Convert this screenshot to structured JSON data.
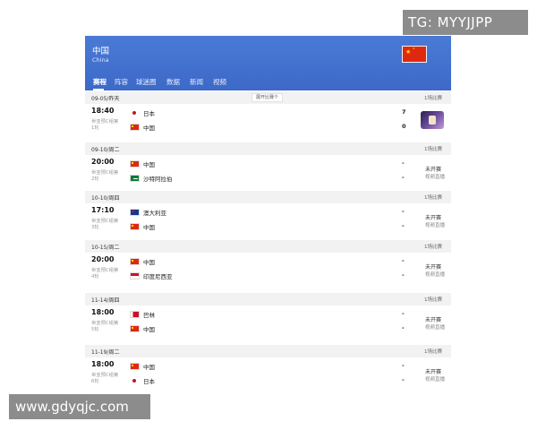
{
  "watermarks": {
    "top_right": "TG: MYYJJPP",
    "bottom_left": "www.gdyqjc.com"
  },
  "header": {
    "team_name": "中国",
    "team_name_en": "China"
  },
  "tabs": [
    "赛程",
    "阵容",
    "球迷圈",
    "数据",
    "新闻",
    "视频"
  ],
  "more_button": "展开比赛个",
  "groups": [
    {
      "date": "09-05/昨天",
      "count": "1场比赛",
      "matches": [
        {
          "time": "18:40",
          "competition": "世亚预C组第",
          "round": "1轮",
          "home": "日本",
          "home_flag": "jp",
          "away": "中国",
          "away_flag": "cn",
          "home_score": "7",
          "away_score": "0",
          "status": "",
          "status_sub": "",
          "has_thumb": true
        }
      ]
    },
    {
      "date": "09-10/周二",
      "count": "1场比赛",
      "matches": [
        {
          "time": "20:00",
          "competition": "世亚预C组第",
          "round": "2轮",
          "home": "中国",
          "home_flag": "cn",
          "away": "沙特阿拉伯",
          "away_flag": "sa",
          "home_score": "-",
          "away_score": "-",
          "status": "未开赛",
          "status_sub": "视频直播",
          "has_thumb": false
        }
      ]
    },
    {
      "date": "10-10/周四",
      "count": "1场比赛",
      "matches": [
        {
          "time": "17:10",
          "competition": "世亚预C组第",
          "round": "3轮",
          "home": "澳大利亚",
          "home_flag": "au",
          "away": "中国",
          "away_flag": "cn",
          "home_score": "-",
          "away_score": "-",
          "status": "未开赛",
          "status_sub": "视频直播",
          "has_thumb": false
        }
      ]
    },
    {
      "date": "10-15/周二",
      "count": "1场比赛",
      "matches": [
        {
          "time": "20:00",
          "competition": "世亚预C组第",
          "round": "4轮",
          "home": "中国",
          "home_flag": "cn",
          "away": "印度尼西亚",
          "away_flag": "id",
          "home_score": "-",
          "away_score": "-",
          "status": "未开赛",
          "status_sub": "视频直播",
          "has_thumb": false
        }
      ]
    },
    {
      "date": "11-14/周四",
      "count": "1场比赛",
      "matches": [
        {
          "time": "18:00",
          "competition": "世亚预C组第",
          "round": "5轮",
          "home": "巴林",
          "home_flag": "bh",
          "away": "中国",
          "away_flag": "cn",
          "home_score": "-",
          "away_score": "-",
          "status": "未开赛",
          "status_sub": "视频直播",
          "has_thumb": false
        }
      ]
    },
    {
      "date": "11-19/周二",
      "count": "1场比赛",
      "matches": [
        {
          "time": "18:00",
          "competition": "世亚预C组第",
          "round": "6轮",
          "home": "中国",
          "home_flag": "cn",
          "away": "日本",
          "away_flag": "jp",
          "home_score": "-",
          "away_score": "-",
          "status": "未开赛",
          "status_sub": "视频直播",
          "has_thumb": false
        }
      ]
    }
  ]
}
